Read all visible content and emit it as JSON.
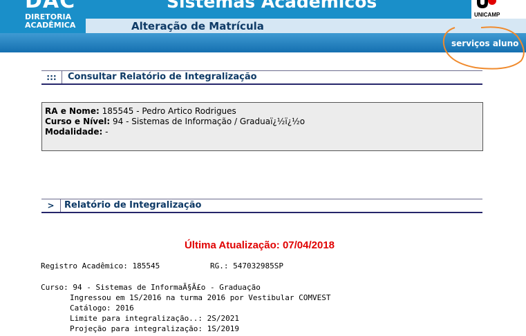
{
  "header": {
    "logo": {
      "main": "DAC",
      "line1": "DIRETORIA",
      "line2": "ACADÊMICA"
    },
    "system_title": "Sistemas Acadêmicos",
    "unicamp_label": "UNICAMP",
    "page_title": "Alteração de Matrícula",
    "services_link": "serviços aluno"
  },
  "section_consult": {
    "marker": ":::",
    "title": "Consultar Relatório de Integralização"
  },
  "student": {
    "ra_label": "RA e Nome:",
    "ra_value": "185545 -  Pedro Artico Rodrigues",
    "course_label": "Curso e Nível:",
    "course_value": "94 - Sistemas de Informação / Graduaï¿½ï¿½o",
    "mode_label": "Modalidade:",
    "mode_value": "-"
  },
  "section_report": {
    "marker": ">",
    "title": "Relatório de Integralização"
  },
  "report": {
    "last_update": "Última Atualização: 07/04/2018",
    "registro": "Registro Acadêmico: 185545",
    "rg": "RG.: 547032985SP",
    "curso": "Curso: 94 - Sistemas de InformaÃ§Ã£o - Graduação",
    "ingresso": "Ingressou em 1S/2016 na turma 2016 por Vestibular COMVEST",
    "catalogo": "Catálogo: 2016",
    "limite": "Limite para integralização..: 2S/2021",
    "projecao": "Projeção para integralização: 1S/2019"
  },
  "colors": {
    "header_blue": "#1a8fc9",
    "title_navy": "#0e3a66",
    "update_red": "#e00000",
    "annotation_orange": "#f08a2c"
  },
  "icons": {
    "unicamp_logo": "unicamp-logo-icon"
  }
}
